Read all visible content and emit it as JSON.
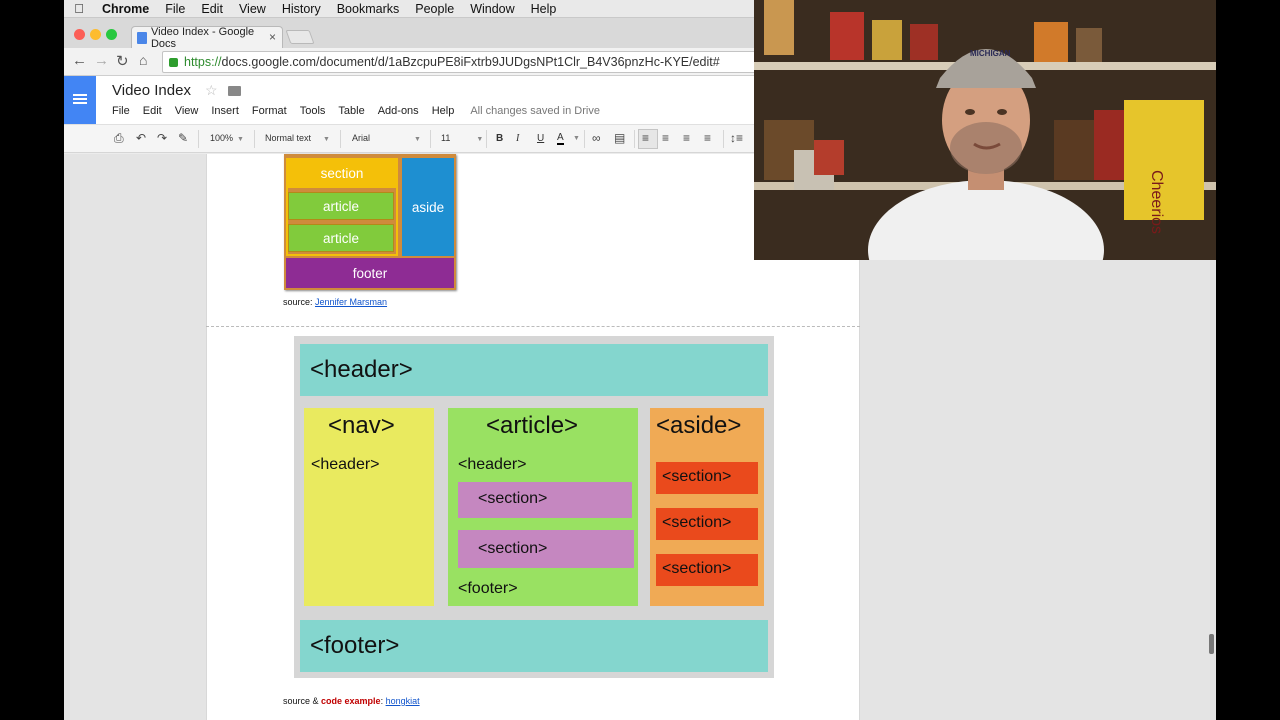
{
  "menubar": {
    "app_name": "Chrome",
    "items": [
      "File",
      "Edit",
      "View",
      "History",
      "Bookmarks",
      "People",
      "Window",
      "Help"
    ]
  },
  "browser": {
    "tab_title": "Video Index - Google Docs",
    "tab_close": "×",
    "url_proto": "https://",
    "url_rest": "docs.google.com/document/d/1aBzcpuPE8iFxtrb9JUDgsNPt1Clr_B4V36pnzHc-KYE/edit#"
  },
  "docs": {
    "title": "Video Index",
    "menu": [
      "File",
      "Edit",
      "View",
      "Insert",
      "Format",
      "Tools",
      "Table",
      "Add-ons",
      "Help"
    ],
    "save_status": "All changes saved in Drive"
  },
  "format_toolbar": {
    "zoom": "100%",
    "style": "Normal text",
    "font": "Arial",
    "size": "11",
    "bold": "B",
    "italic": "I",
    "underline": "U",
    "text_color": "A"
  },
  "figure1": {
    "section": "section",
    "article_1": "article",
    "article_2": "article",
    "aside": "aside",
    "footer": "footer",
    "source_prefix": "source: ",
    "source_link": "Jennifer Marsman"
  },
  "figure2": {
    "header": "<header>",
    "nav": "<nav>",
    "nav_header": "<header>",
    "article": "<article>",
    "article_header": "<header>",
    "article_section_1": "<section>",
    "article_section_2": "<section>",
    "article_footer": "<footer>",
    "aside": "<aside>",
    "aside_section_1": "<section>",
    "aside_section_2": "<section>",
    "aside_section_3": "<section>",
    "footer": "<footer>",
    "source_prefix": "source & ",
    "source_bold": "code example",
    "source_colon": ": ",
    "source_link": "hongkiat"
  },
  "colors": {
    "teal": "#84d6ce",
    "yellow": "#e9ea5f",
    "green": "#99e162",
    "orange": "#f0aa55",
    "purple": "#c587c0",
    "red": "#ea4a1c",
    "docs_blue": "#4285f4"
  },
  "webcam_cap_text": "MICHIGAN",
  "pantry_box_text": "Cheerios"
}
